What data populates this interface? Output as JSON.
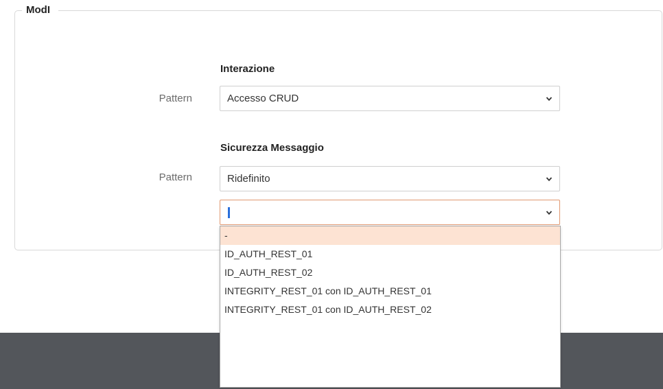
{
  "fieldset": {
    "legend": "ModI"
  },
  "interazione": {
    "title": "Interazione",
    "pattern_label": "Pattern",
    "pattern_value": "Accesso CRUD"
  },
  "sicurezza": {
    "title": "Sicurezza Messaggio",
    "pattern_label": "Pattern",
    "pattern_value": "Ridefinito",
    "profile_value": ""
  },
  "dropdown": {
    "options": [
      "-",
      "ID_AUTH_REST_01",
      "ID_AUTH_REST_02",
      "INTEGRITY_REST_01 con ID_AUTH_REST_01",
      "INTEGRITY_REST_01 con ID_AUTH_REST_02"
    ],
    "selected_index": 0
  },
  "colors": {
    "focus_border": "#e0976f",
    "selected_option_bg": "#fde3d3",
    "footer_bg": "#53565b"
  }
}
